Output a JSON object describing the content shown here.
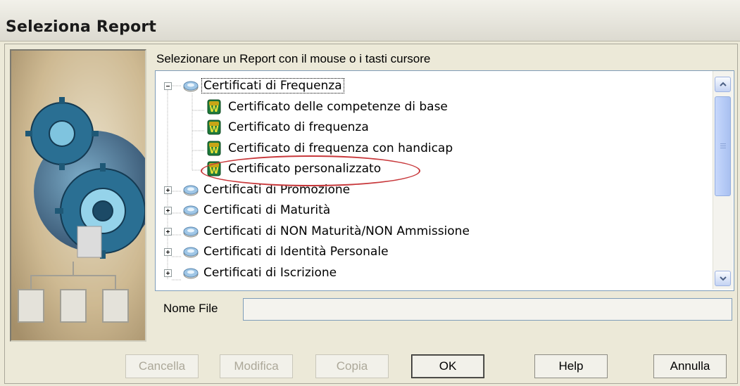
{
  "window": {
    "title": "Seleziona Report"
  },
  "instruction": "Selezionare un Report con il mouse o i tasti cursore",
  "tree": {
    "groups": [
      {
        "label": "Certificati di Frequenza",
        "expanded": true,
        "selected": true,
        "children": [
          "Certificato delle competenze di base",
          "Certificato di frequenza",
          "Certificato di frequenza con handicap",
          "Certificato personalizzato"
        ]
      },
      {
        "label": "Certificati di Promozione",
        "expanded": false
      },
      {
        "label": "Certificati di Maturità",
        "expanded": false
      },
      {
        "label": "Certificati di NON Maturità/NON Ammissione",
        "expanded": false
      },
      {
        "label": "Certificati di Identità Personale",
        "expanded": false
      },
      {
        "label": "Certificati di Iscrizione",
        "expanded": false
      }
    ]
  },
  "filename": {
    "label": "Nome File",
    "value": ""
  },
  "buttons": {
    "cancella": "Cancella",
    "modifica": "Modifica",
    "copia": "Copia",
    "ok": "OK",
    "help": "Help",
    "annulla": "Annulla"
  },
  "icons": {
    "folder": "report-group-icon",
    "document": "word-report-icon"
  },
  "colors": {
    "annotation": "#c8393c",
    "selection_border": "#7f9db9"
  }
}
